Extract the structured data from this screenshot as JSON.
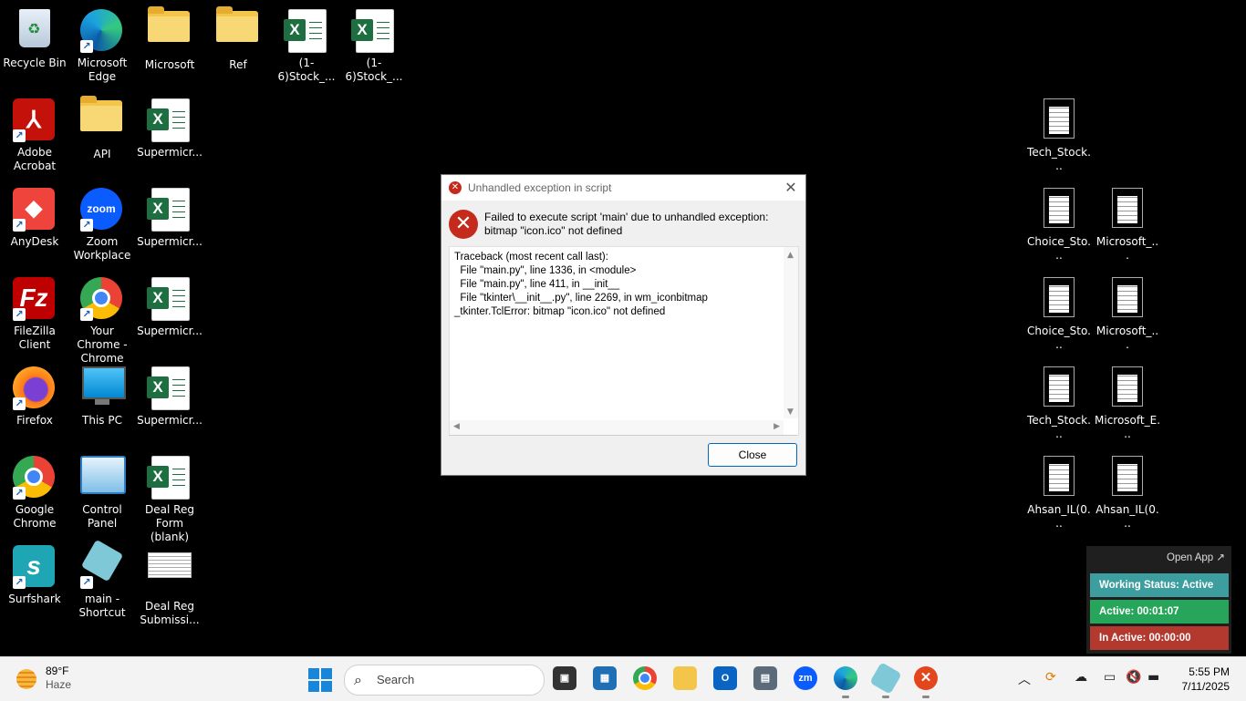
{
  "desktop": {
    "icons": [
      {
        "label": "Recycle Bin"
      },
      {
        "label": "Microsoft Edge"
      },
      {
        "label": "Microsoft"
      },
      {
        "label": "Ref"
      },
      {
        "label": "(1-6)Stock_..."
      },
      {
        "label": "(1-6)Stock_..."
      },
      {
        "label": "Adobe Acrobat"
      },
      {
        "label": "API"
      },
      {
        "label": "Supermicr..."
      },
      {
        "label": "AnyDesk"
      },
      {
        "label": "Zoom Workplace"
      },
      {
        "label": "Supermicr..."
      },
      {
        "label": "FileZilla Client"
      },
      {
        "label": "Your Chrome - Chrome"
      },
      {
        "label": "Supermicr..."
      },
      {
        "label": "Firefox"
      },
      {
        "label": "This PC"
      },
      {
        "label": "Supermicr..."
      },
      {
        "label": "Google Chrome"
      },
      {
        "label": "Control Panel"
      },
      {
        "label": "Deal Reg Form (blank)"
      },
      {
        "label": "Surfshark"
      },
      {
        "label": "main - Shortcut"
      },
      {
        "label": "Deal Reg Submissi..."
      },
      {
        "label": "Tech_Stock..."
      },
      {
        "label": "Choice_Sto..."
      },
      {
        "label": "Microsoft_..."
      },
      {
        "label": "Choice_Sto..."
      },
      {
        "label": "Microsoft_..."
      },
      {
        "label": "Tech_Stock..."
      },
      {
        "label": "Microsoft_E..."
      },
      {
        "label": "Ahsan_IL(0..."
      },
      {
        "label": "Ahsan_IL(0..."
      }
    ]
  },
  "dialog": {
    "title": "Unhandled exception in script",
    "message_line1": "Failed to execute script 'main' due to unhandled exception:",
    "message_line2": "bitmap \"icon.ico\" not defined",
    "traceback": "Traceback (most recent call last):\n  File \"main.py\", line 1336, in <module>\n  File \"main.py\", line 411, in __init__\n  File \"tkinter\\__init__.py\", line 2269, in wm_iconbitmap\n_tkinter.TclError: bitmap \"icon.ico\" not defined",
    "close_label": "Close"
  },
  "widget": {
    "open_app": "Open App ↗",
    "working_status": "Working Status: Active",
    "active": "Active: 00:01:07",
    "inactive": "In Active: 00:00:00",
    "colors": {
      "status": "#3d9ea0",
      "active": "#27a55a",
      "inactive": "#b3392f"
    }
  },
  "taskbar": {
    "weather_temp": "89°F",
    "weather_cond": "Haze",
    "search_placeholder": "Search",
    "zoom_badge": "zm",
    "time": "5:55 PM",
    "date": "7/11/2025"
  }
}
